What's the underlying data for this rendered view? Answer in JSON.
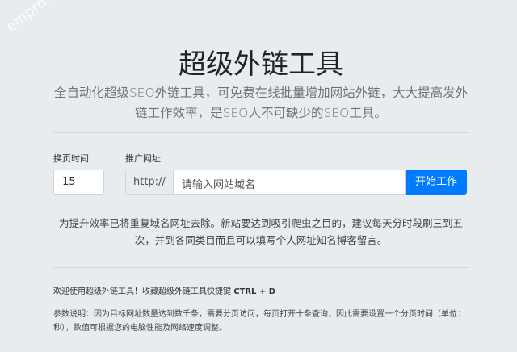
{
  "watermark": "emprd.com",
  "title": "超级外链工具",
  "lead": "全自动化超级SEO外链工具，可免费在线批量增加网站外链，大大提高发外链工作效率，是SEO人不可缺少的SEO工具。",
  "form": {
    "page_time_label": "换页时间",
    "page_time_value": "15",
    "url_label": "推广网址",
    "url_prefix": "http://",
    "url_placeholder": "请输入网站域名",
    "start_button": "开始工作"
  },
  "tip": "为提升效率已将重复域名网址去除。新站要达到吸引爬虫之目的，建议每天分时段刷三到五次，并到各同类目而且可以填写个人网址知名博客留言。",
  "welcome_text": "欢迎使用超级外链工具！收藏超级外链工具快捷键 ",
  "shortcut": "CTRL + D",
  "params": "参数说明：因为目标网址数量达到数千条，需要分页访问，每页打开十条查询，因此需要设置一个分页时间（单位：秒），数值可根据您的电脑性能及网络速度调整。"
}
